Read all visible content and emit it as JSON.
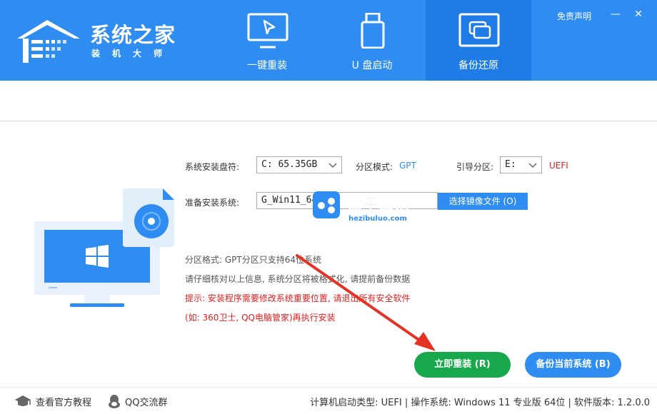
{
  "header": {
    "logo_title": "系统之家",
    "logo_subtitle": "装机大师",
    "disclaimer": "免责声明",
    "minimize": "—",
    "close": "✕",
    "tabs": [
      {
        "label": "一键重装",
        "icon": "cursor-monitor-icon"
      },
      {
        "label": "U 盘启动",
        "icon": "usb-drive-icon"
      },
      {
        "label": "备份还原",
        "icon": "copy-windows-icon",
        "active": true
      }
    ]
  },
  "form": {
    "disk_label": "系统安装盘符:",
    "disk_value": "C: 65.35GB",
    "partition_mode_label": "分区模式:",
    "partition_mode_value": "GPT",
    "boot_partition_label": "引导分区:",
    "boot_partition_value": "E:",
    "boot_type": "UEFI",
    "system_label": "准备安装系统:",
    "system_value": "G_Win11_64",
    "browse_button": "选择镜像文件 (O)"
  },
  "info": {
    "line1": "分区格式: GPT分区只支持64位系统",
    "line2": "请仔细核对以上信息, 系统分区将被格式化, 请提前备份数据",
    "warning1": "提示: 安装程序需要修改系统重要位置, 请退出所有安全软件",
    "warning2": "(如: 360卫士, QQ电脑管家)再执行安装"
  },
  "watermark": {
    "text": "盒子部落",
    "url": "hezibuluo.com"
  },
  "actions": {
    "reinstall": "立即重装 (R)",
    "backup": "备份当前系统 (B)"
  },
  "footer": {
    "tutorial": "查看官方教程",
    "qq_group": "QQ交流群",
    "status": "计算机启动类型: UEFI | 操作系统: Windows 11 专业版 64位 | 软件版本: 1.2.0.0"
  },
  "colors": {
    "header": "#2f8df2",
    "active_tab": "#1f7ce6",
    "primary_green": "#16a84a",
    "warning_red": "#e02020"
  }
}
